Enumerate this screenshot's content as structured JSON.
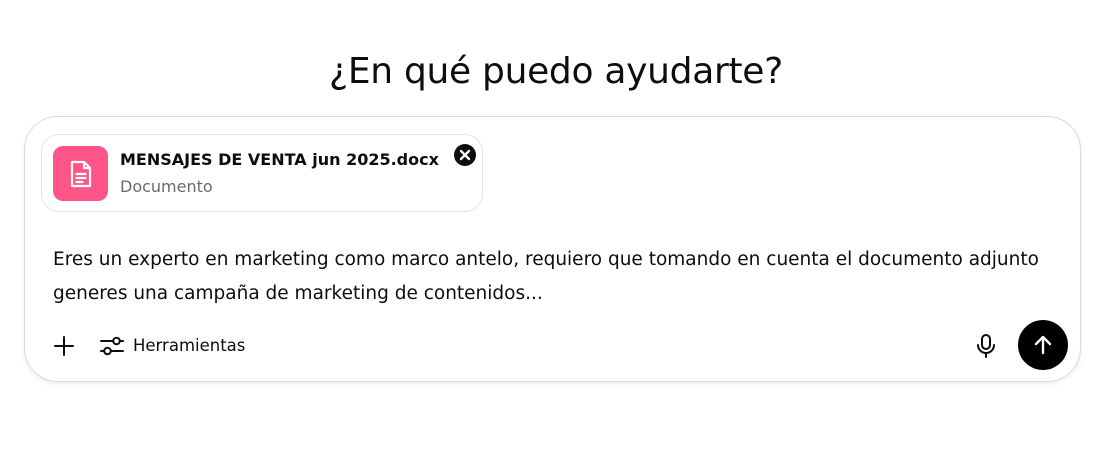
{
  "heading": "¿En qué puedo ayudarte?",
  "attachment": {
    "file_name": "MENSAJES DE VENTA jun 2025.docx",
    "file_type": "Documento",
    "icon": "document-icon",
    "icon_color": "#ff5588"
  },
  "prompt": {
    "text": "Eres un experto en marketing como marco antelo, requiero que tomando en cuenta el documento adjunto generes una campaña de marketing de contenidos..."
  },
  "toolbar": {
    "plus_icon": "plus-icon",
    "tools_icon": "sliders-icon",
    "tools_label": "Herramientas",
    "mic_icon": "microphone-icon",
    "send_icon": "arrow-up-icon"
  },
  "colors": {
    "send_button": "#000000",
    "border": "#dadada",
    "muted_text": "#6b6b6b"
  }
}
